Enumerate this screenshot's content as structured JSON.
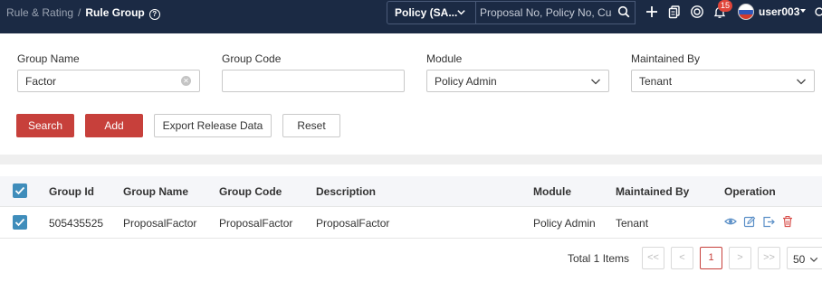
{
  "header": {
    "breadcrumb_parent": "Rule & Rating",
    "breadcrumb_separator": "/",
    "breadcrumb_current": "Rule Group",
    "help_icon": "?",
    "module_selector": "Policy (SA...",
    "search_placeholder": "Proposal No, Policy No, Cust",
    "notification_count": "15",
    "username": "user003"
  },
  "filters": {
    "group_name": {
      "label": "Group Name",
      "value": "Factor"
    },
    "group_code": {
      "label": "Group Code",
      "value": ""
    },
    "module": {
      "label": "Module",
      "value": "Policy Admin"
    },
    "maintained_by": {
      "label": "Maintained By",
      "value": "Tenant"
    }
  },
  "actions": {
    "search": "Search",
    "add": "Add",
    "export": "Export Release Data",
    "reset": "Reset"
  },
  "table": {
    "columns": [
      "Group Id",
      "Group Name",
      "Group Code",
      "Description",
      "Module",
      "Maintained By",
      "Operation"
    ],
    "rows": [
      {
        "checked": true,
        "group_id": "505435525",
        "group_name": "ProposalFactor",
        "group_code": "ProposalFactor",
        "description": "ProposalFactor",
        "module": "Policy Admin",
        "maintained_by": "Tenant",
        "operations": [
          "view-icon",
          "edit-icon",
          "export-icon",
          "delete-icon"
        ]
      }
    ]
  },
  "pagination": {
    "total": "Total 1 Items",
    "first": "<<",
    "prev": "<",
    "current_page": "1",
    "next": ">",
    "last": ">>",
    "page_size": "50"
  },
  "colors": {
    "topbar": "#1b2a44",
    "primary": "#c7403b",
    "checkbox": "#3f8dbb",
    "icon": "#5b8fc7",
    "delete": "#d9534f"
  }
}
